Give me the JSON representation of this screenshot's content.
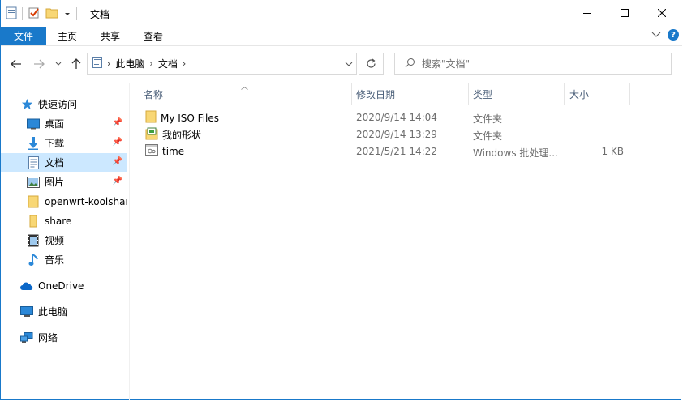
{
  "window": {
    "title": "文档"
  },
  "ribbon": {
    "tabs": [
      "文件",
      "主页",
      "共享",
      "查看"
    ]
  },
  "address": {
    "crumbs": [
      "此电脑",
      "文档"
    ]
  },
  "search": {
    "placeholder": "搜索\"文档\""
  },
  "sidebar": {
    "items": [
      {
        "label": "快速访问",
        "icon": "star-icon",
        "pinned": false
      },
      {
        "label": "桌面",
        "icon": "desktop-icon",
        "pinned": true
      },
      {
        "label": "下载",
        "icon": "download-icon",
        "pinned": true
      },
      {
        "label": "文档",
        "icon": "documents-icon",
        "pinned": true,
        "selected": true
      },
      {
        "label": "图片",
        "icon": "pictures-icon",
        "pinned": true
      },
      {
        "label": "openwrt-koolshar",
        "icon": "folder-icon",
        "pinned": false
      },
      {
        "label": "share",
        "icon": "folder-icon",
        "pinned": false
      },
      {
        "label": "视频",
        "icon": "video-icon",
        "pinned": false
      },
      {
        "label": "音乐",
        "icon": "music-icon",
        "pinned": false
      },
      {
        "label": "OneDrive",
        "icon": "cloud-icon",
        "pinned": false
      },
      {
        "label": "此电脑",
        "icon": "computer-icon",
        "pinned": false
      },
      {
        "label": "网络",
        "icon": "network-icon",
        "pinned": false
      }
    ]
  },
  "columns": {
    "name": "名称",
    "modified": "修改日期",
    "type": "类型",
    "size": "大小"
  },
  "files": [
    {
      "name": "My ISO Files",
      "modified": "2020/9/14 14:04",
      "type": "文件夹",
      "size": "",
      "icon": "folder-icon"
    },
    {
      "name": "我的形状",
      "modified": "2020/9/14 13:29",
      "type": "文件夹",
      "size": "",
      "icon": "shapes-folder-icon"
    },
    {
      "name": "time",
      "modified": "2021/5/21 14:22",
      "type": "Windows 批处理...",
      "size": "1 KB",
      "icon": "batch-file-icon"
    }
  ],
  "colors": {
    "accent": "#1979ca",
    "selected": "#cce8ff",
    "folder": "#f8d775"
  }
}
